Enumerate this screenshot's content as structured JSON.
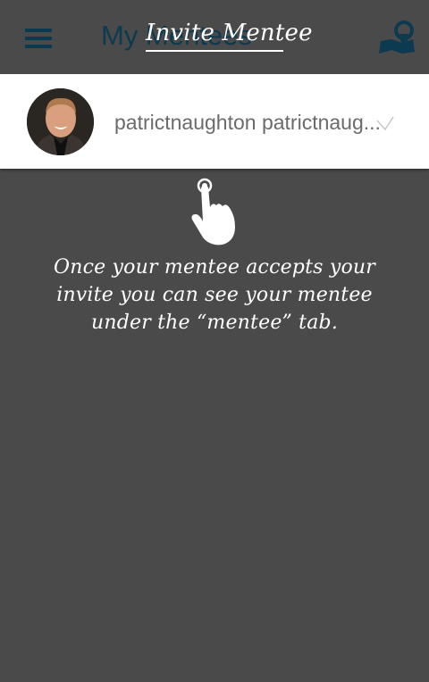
{
  "appbar": {
    "title": "My Mentees",
    "menu_icon": "hamburger-menu-icon",
    "map_icon": "map-location-icon",
    "accent_color": "#0c3a50"
  },
  "coachmark": {
    "title": "Invite Mentee",
    "hand_icon": "pointing-hand-icon",
    "message": "Once your mentee accepts your invite you can see your mentee under the “mentee” tab."
  },
  "mentee_list": [
    {
      "name": "patrictnaughton patrictnaug...",
      "avatar": "profile-photo",
      "status_icon": "check-icon"
    }
  ],
  "colors": {
    "overlay": "#4a4a4a",
    "row_background": "#ffffff",
    "row_text": "#6b6b6b"
  }
}
